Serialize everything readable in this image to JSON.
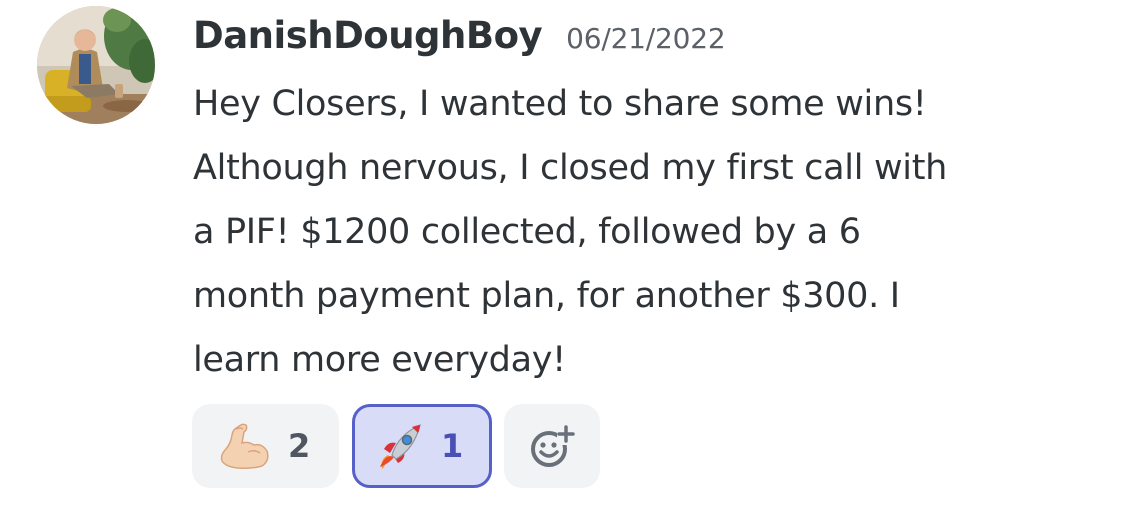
{
  "message": {
    "author": "DanishDoughBoy",
    "timestamp": "06/21/2022",
    "lines": [
      "Hey Closers, I wanted to share some wins!",
      "Although nervous, I closed my first call with",
      "a PIF! $1200 collected, followed by a 6",
      "month payment plan, for another $300. I",
      "learn more everyday!"
    ]
  },
  "reactions": [
    {
      "icon": "flexed-biceps-emoji",
      "count": "2",
      "selected": false
    },
    {
      "icon": "rocket-emoji",
      "count": "1",
      "selected": true
    },
    {
      "icon": "add-reaction-icon"
    }
  ],
  "colors": {
    "text": "#2e3338",
    "muted": "#5c6168",
    "reaction_bg": "#f2f3f5",
    "selected_bg": "#d8dcf6",
    "selected_border": "#5660c9"
  }
}
